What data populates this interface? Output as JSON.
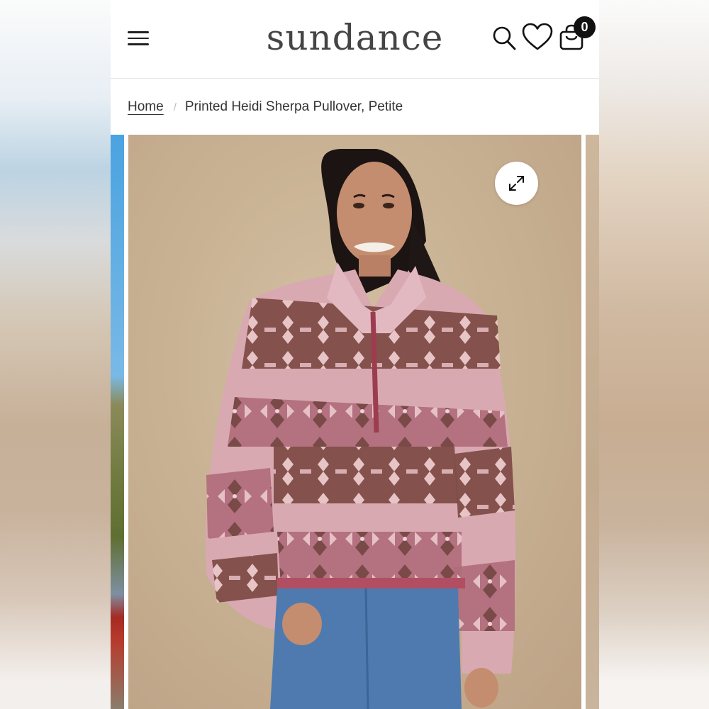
{
  "brand": {
    "logo_text": "sundance"
  },
  "header": {
    "menu_icon": "hamburger-menu-icon",
    "search_icon": "search-icon",
    "wishlist_icon": "heart-icon",
    "cart_icon": "shopping-bag-icon",
    "cart_count": "0"
  },
  "breadcrumb": {
    "home": "Home",
    "separator": "/",
    "current": "Printed Heidi Sherpa Pullover, Petite"
  },
  "gallery": {
    "expand_icon": "expand-arrows-icon"
  },
  "colors": {
    "background": "#ffffff",
    "text": "#333333",
    "badge": "#111111"
  }
}
